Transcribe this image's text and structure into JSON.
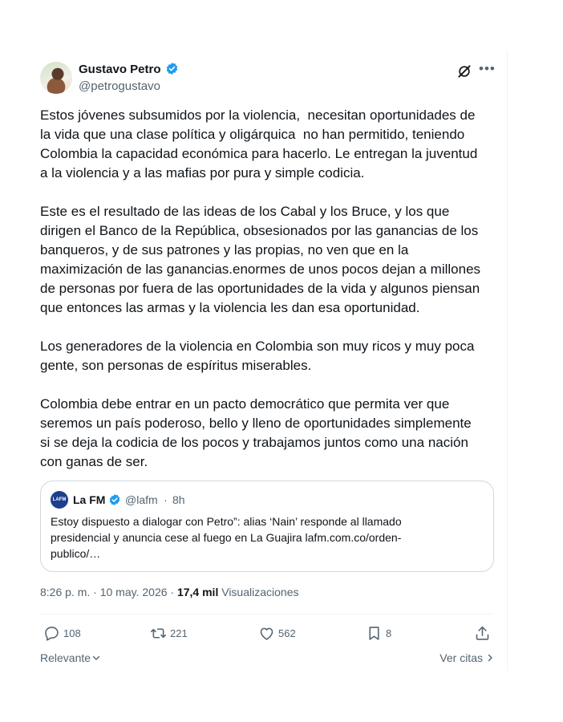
{
  "tweet": {
    "author_name": "Gustavo Petro",
    "handle": "@petrogustavo",
    "text": "Estos jóvenes subsumidos por la violencia,  necesitan oportunidades de\nla vida que una clase política y oligárquica  no han permitido, teniendo\nColombia la capacidad económica para hacerlo. Le entregan la juventud\na la violencia y a las mafias por pura y simple codicia.\n\nEste es el resultado de las ideas de los Cabal y los Bruce, y los que\ndirigen el Banco de la República, obsesionados por las ganancias de los\nbanqueros, y de sus patrones y las propias, no ven que en la\nmaximización de las ganancias.enormes de unos pocos dejan a millones\nde personas por fuera de las oportunidades de la vida y algunos piensan\nque entonces las armas y la violencia les dan esa oportunidad.\n\nLos generadores de la violencia en Colombia son muy ricos y muy poca\ngente, son personas de espíritus miserables.\n\nColombia debe entrar en un pacto democrático que permita ver que\nseremos un país poderoso, bello y lleno de oportunidades simplemente\nsi se deja la codicia de los pocos y trabajamos juntos como una nación\ncon ganas de ser.",
    "time": "8:26 p. m.",
    "date": "10 may. 2026",
    "views_count": "17,4 mil",
    "views_label": "Visualizaciones",
    "separator": "·"
  },
  "quote": {
    "avatar_text": "LAFM",
    "author_name": "La FM",
    "handle": "@lafm",
    "separator": "·",
    "time": "8h",
    "text": "Estoy dispuesto a dialogar con Petro”: alias ‘Nain’ responde al llamado\npresidencial y anuncia cese al fuego en La Guajira lafm.com.co/orden-\npublico/…"
  },
  "actions": {
    "replies": "108",
    "reposts": "221",
    "likes": "562",
    "bookmarks": "8"
  },
  "footer": {
    "sort_label": "Relevante",
    "quotes_link": "Ver citas"
  },
  "colors": {
    "text": "#0f1419",
    "secondary": "#536471",
    "verified": "#1d9bf0",
    "border": "#cfd9de"
  },
  "icons": [
    "verified-badge-icon",
    "grok-icon",
    "more-icon",
    "reply-icon",
    "repost-icon",
    "like-icon",
    "bookmark-icon",
    "share-icon",
    "chevron-down-icon",
    "chevron-right-icon"
  ]
}
